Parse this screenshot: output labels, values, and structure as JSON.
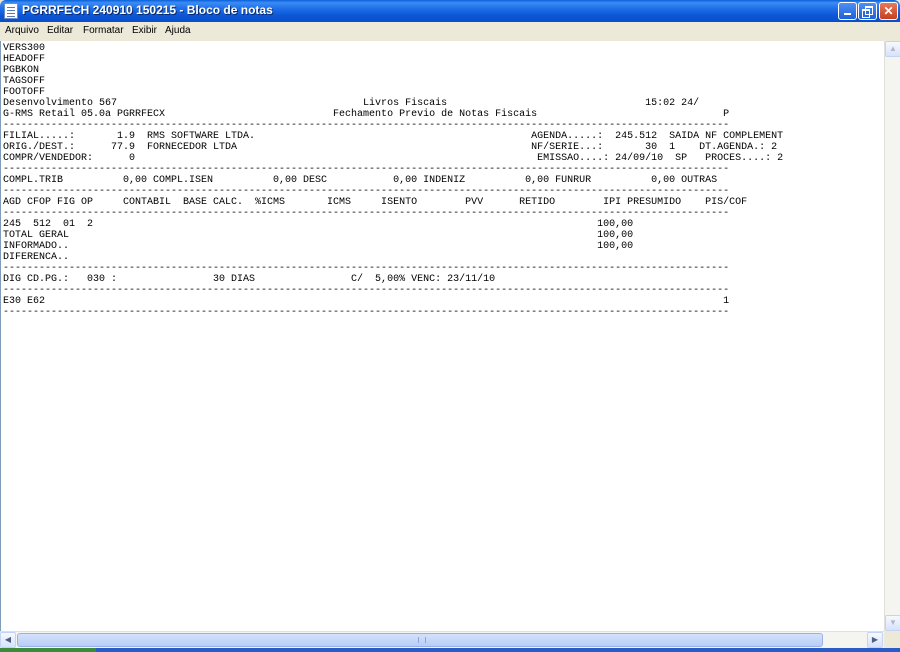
{
  "window": {
    "title": "PGRRFECH 240910 150215 - Bloco de notas"
  },
  "menu": [
    {
      "label": "Arquivo"
    },
    {
      "label": "Editar"
    },
    {
      "label": "Formatar"
    },
    {
      "label": "Exibir"
    },
    {
      "label": "Ajuda"
    }
  ],
  "document": {
    "lines": [
      "VERS300",
      "HEADOFF",
      "PGBKON",
      "TAGSOFF",
      "FOOTOFF",
      "Desenvolvimento 567                                         Livros Fiscais                                 15:02 24/",
      "G-RMS Retail 05.0a PGRRFECX                            Fechamento Previo de Notas Fiscais                               P",
      "-------------------------------------------------------------------------------------------------------------------------",
      "FILIAL.....:       1.9  RMS SOFTWARE LTDA.                                              AGENDA.....:  245.512  SAIDA NF COMPLEMENT",
      "ORIG./DEST.:      77.9  FORNECEDOR LTDA                                                 NF/SERIE...:       30  1    DT.AGENDA.: 2",
      "COMPR/VENDEDOR:      0                                                                   EMISSAO....: 24/09/10  SP   PROCES....: 2",
      "-------------------------------------------------------------------------------------------------------------------------",
      "COMPL.TRIB          0,00 COMPL.ISEN          0,00 DESC           0,00 INDENIZ          0,00 FUNRUR          0,00 OUTRAS",
      "-------------------------------------------------------------------------------------------------------------------------",
      "AGD CFOP FIG OP     CONTABIL  BASE CALC.  %ICMS       ICMS     ISENTO        PVV      RETIDO        IPI PRESUMIDO    PIS/COF",
      "-------------------------------------------------------------------------------------------------------------------------",
      "245  512  01  2                                                                                    100,00",
      "TOTAL GERAL                                                                                        100,00",
      "INFORMADO..                                                                                        100,00",
      "DIFERENCA..",
      "-------------------------------------------------------------------------------------------------------------------------",
      "DIG CD.PG.:   030 :                30 DIAS                C/  5,00% VENC: 23/11/10",
      "-------------------------------------------------------------------------------------------------------------------------",
      "E30 E62                                                                                                                 1",
      "-------------------------------------------------------------------------------------------------------------------------"
    ]
  },
  "icons": {
    "app": "notepad-icon",
    "minimize": "minimize-icon",
    "maximize": "restore-icon",
    "close": "close-icon"
  },
  "colors": {
    "titlebar": "#0a56d6",
    "close_button": "#c4401f",
    "editor_bg": "#ffffff"
  }
}
